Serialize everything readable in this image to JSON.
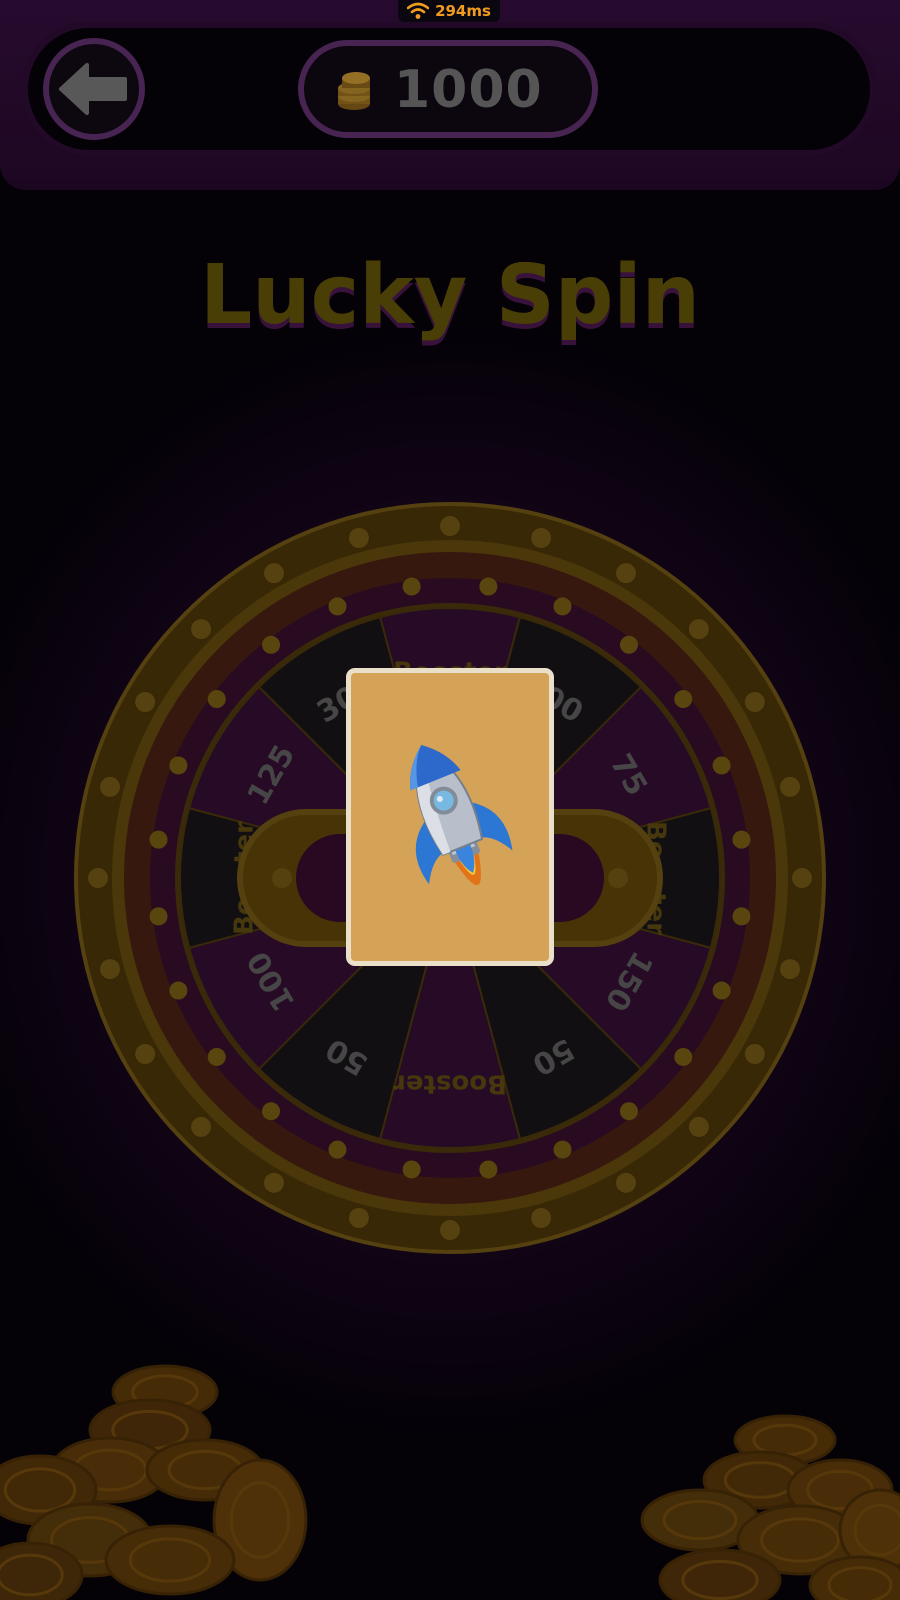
{
  "status": {
    "ping": "294ms",
    "wifi_icon": "wifi-icon"
  },
  "header": {
    "back_icon": "arrow-left-icon",
    "coin_icon": "coin-stack-icon",
    "coins": "1000"
  },
  "title": "Lucky Spin",
  "wheel": {
    "segments": [
      "Booster",
      "200",
      "75",
      "Booster",
      "150",
      "50",
      "Booster",
      "50",
      "100",
      "Booster",
      "125",
      "300"
    ]
  },
  "reward_card": {
    "icon": "rocket-icon",
    "background_color": "#e0ac5c"
  },
  "colors": {
    "gold": "#b8860b",
    "purple": "#2a0c32",
    "accent_orange": "#f29c1f"
  }
}
